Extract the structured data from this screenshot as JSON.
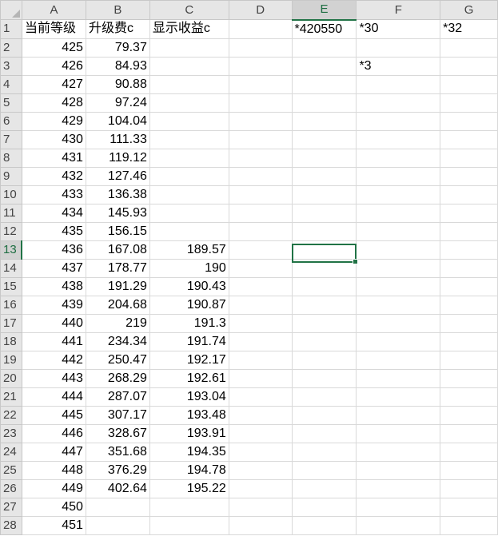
{
  "columns": [
    "A",
    "B",
    "C",
    "D",
    "E",
    "F",
    "G"
  ],
  "active_column": "E",
  "active_row": "13",
  "rows": [
    {
      "n": "1",
      "A": "当前等级",
      "B": "升级费c",
      "C": "显示收益c",
      "D": "",
      "E": "*420550",
      "F": "*30",
      "G": "*32"
    },
    {
      "n": "2",
      "A": "425",
      "B": "79.37",
      "C": "",
      "D": "",
      "E": "",
      "F": "",
      "G": ""
    },
    {
      "n": "3",
      "A": "426",
      "B": "84.93",
      "C": "",
      "D": "",
      "E": "",
      "F": "*3",
      "G": ""
    },
    {
      "n": "4",
      "A": "427",
      "B": "90.88",
      "C": "",
      "D": "",
      "E": "",
      "F": "",
      "G": ""
    },
    {
      "n": "5",
      "A": "428",
      "B": "97.24",
      "C": "",
      "D": "",
      "E": "",
      "F": "",
      "G": ""
    },
    {
      "n": "6",
      "A": "429",
      "B": "104.04",
      "C": "",
      "D": "",
      "E": "",
      "F": "",
      "G": ""
    },
    {
      "n": "7",
      "A": "430",
      "B": "111.33",
      "C": "",
      "D": "",
      "E": "",
      "F": "",
      "G": ""
    },
    {
      "n": "8",
      "A": "431",
      "B": "119.12",
      "C": "",
      "D": "",
      "E": "",
      "F": "",
      "G": ""
    },
    {
      "n": "9",
      "A": "432",
      "B": "127.46",
      "C": "",
      "D": "",
      "E": "",
      "F": "",
      "G": ""
    },
    {
      "n": "10",
      "A": "433",
      "B": "136.38",
      "C": "",
      "D": "",
      "E": "",
      "F": "",
      "G": ""
    },
    {
      "n": "11",
      "A": "434",
      "B": "145.93",
      "C": "",
      "D": "",
      "E": "",
      "F": "",
      "G": ""
    },
    {
      "n": "12",
      "A": "435",
      "B": "156.15",
      "C": "",
      "D": "",
      "E": "",
      "F": "",
      "G": ""
    },
    {
      "n": "13",
      "A": "436",
      "B": "167.08",
      "C": "189.57",
      "D": "",
      "E": "",
      "F": "",
      "G": ""
    },
    {
      "n": "14",
      "A": "437",
      "B": "178.77",
      "C": "190",
      "D": "",
      "E": "",
      "F": "",
      "G": ""
    },
    {
      "n": "15",
      "A": "438",
      "B": "191.29",
      "C": "190.43",
      "D": "",
      "E": "",
      "F": "",
      "G": ""
    },
    {
      "n": "16",
      "A": "439",
      "B": "204.68",
      "C": "190.87",
      "D": "",
      "E": "",
      "F": "",
      "G": ""
    },
    {
      "n": "17",
      "A": "440",
      "B": "219",
      "C": "191.3",
      "D": "",
      "E": "",
      "F": "",
      "G": ""
    },
    {
      "n": "18",
      "A": "441",
      "B": "234.34",
      "C": "191.74",
      "D": "",
      "E": "",
      "F": "",
      "G": ""
    },
    {
      "n": "19",
      "A": "442",
      "B": "250.47",
      "C": "192.17",
      "D": "",
      "E": "",
      "F": "",
      "G": ""
    },
    {
      "n": "20",
      "A": "443",
      "B": "268.29",
      "C": "192.61",
      "D": "",
      "E": "",
      "F": "",
      "G": ""
    },
    {
      "n": "21",
      "A": "444",
      "B": "287.07",
      "C": "193.04",
      "D": "",
      "E": "",
      "F": "",
      "G": ""
    },
    {
      "n": "22",
      "A": "445",
      "B": "307.17",
      "C": "193.48",
      "D": "",
      "E": "",
      "F": "",
      "G": ""
    },
    {
      "n": "23",
      "A": "446",
      "B": "328.67",
      "C": "193.91",
      "D": "",
      "E": "",
      "F": "",
      "G": ""
    },
    {
      "n": "24",
      "A": "447",
      "B": "351.68",
      "C": "194.35",
      "D": "",
      "E": "",
      "F": "",
      "G": ""
    },
    {
      "n": "25",
      "A": "448",
      "B": "376.29",
      "C": "194.78",
      "D": "",
      "E": "",
      "F": "",
      "G": ""
    },
    {
      "n": "26",
      "A": "449",
      "B": "402.64",
      "C": "195.22",
      "D": "",
      "E": "",
      "F": "",
      "G": ""
    },
    {
      "n": "27",
      "A": "450",
      "B": "",
      "C": "",
      "D": "",
      "E": "",
      "F": "",
      "G": ""
    },
    {
      "n": "28",
      "A": "451",
      "B": "",
      "C": "",
      "D": "",
      "E": "",
      "F": "",
      "G": ""
    }
  ],
  "colors": {
    "selection": "#217346",
    "header_bg": "#e6e6e6",
    "gridline": "#d9d9d9"
  }
}
